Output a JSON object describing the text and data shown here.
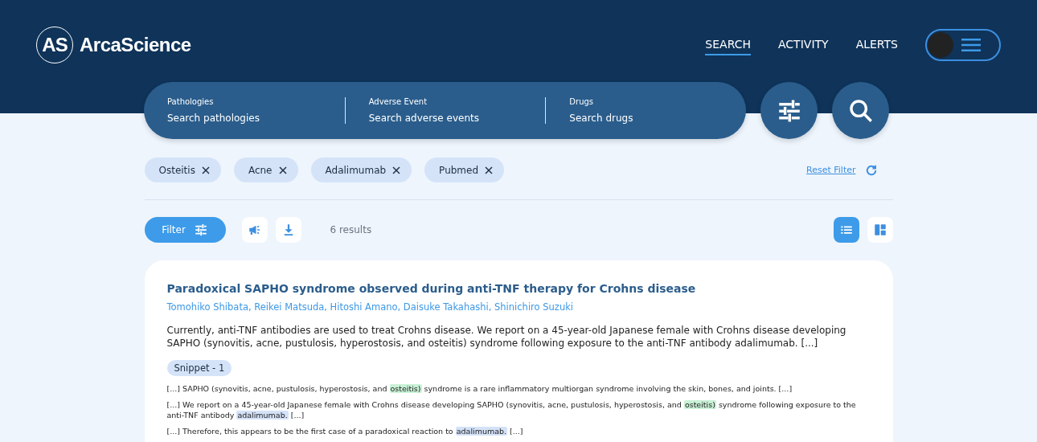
{
  "brand": {
    "logo": "AS",
    "name": "ArcaScience"
  },
  "nav": [
    {
      "label": "SEARCH",
      "selected": true
    },
    {
      "label": "ACTIVITY",
      "selected": false
    },
    {
      "label": "ALERTS",
      "selected": false
    }
  ],
  "search_fields": [
    {
      "label": "Pathologies",
      "placeholder": "Search pathologies"
    },
    {
      "label": "Adverse Event",
      "placeholder": "Search adverse events"
    },
    {
      "label": "Drugs",
      "placeholder": "Search drugs"
    }
  ],
  "chips": [
    "Osteitis",
    "Acne",
    "Adalimumab",
    "Pubmed"
  ],
  "reset_filter": "Reset Filter",
  "toolbar": {
    "filter_button": "Filter",
    "results": "6 results",
    "views": [
      {
        "kind": "list",
        "selected": true
      },
      {
        "kind": "grid",
        "selected": false
      }
    ]
  },
  "result": {
    "title": "Paradoxical SAPHO syndrome observed during anti-TNF therapy for Crohns disease",
    "authors": "Tomohiko Shibata, Reikei Matsuda, Hitoshi Amano, Daisuke Takahashi, Shinichiro Suzuki",
    "abstract": "Currently, anti-TNF antibodies are used to treat Crohns disease. We report on a 45-year-old Japanese female with Crohns disease developing SAPHO (synovitis, acne, pustulosis, hyperostosis, and osteitis) syndrome following exposure to the anti-TNF antibody adalimumab. [...]",
    "snippet_label": "Snippet - 1",
    "snippets": [
      [
        {
          "text": "[...] SAPHO (synovitis, acne, pustulosis, hyperostosis, and "
        },
        {
          "text": "osteitis)",
          "color": "#c8f1d6"
        },
        {
          "text": " syndrome is a rare inflammatory multiorgan syndrome involving the skin, bones, and joints. [...]"
        }
      ],
      [
        {
          "text": "[...] We report on a 45-year-old Japanese female with Crohns disease developing SAPHO (synovitis, acne, pustulosis, hyperostosis, and "
        },
        {
          "text": "osteitis)",
          "color": "#c8f1d6"
        },
        {
          "text": " syndrome following exposure to the anti-TNF antibody "
        },
        {
          "text": "adalimumab.",
          "color": "#d4e2f8"
        },
        {
          "text": " [...]"
        }
      ],
      [
        {
          "text": "[...] Therefore, this appears to be the first case of a paradoxical reaction to "
        },
        {
          "text": "adalimumab.",
          "color": "#d4e2f8"
        },
        {
          "text": " [...]"
        }
      ]
    ]
  }
}
